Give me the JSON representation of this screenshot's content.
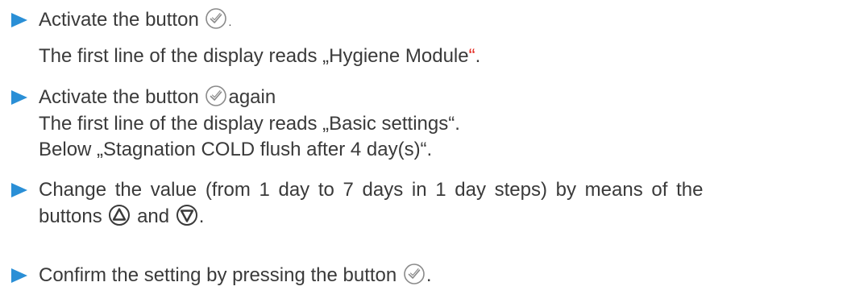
{
  "colors": {
    "text": "#3a3a3a",
    "arrow": "#2a8fd6",
    "icon_stroke": "#8a8a8a",
    "highlight": "#e2231a"
  },
  "step1": {
    "icon": "play-arrow-icon",
    "line1_prefix": "Activate the button",
    "line1_suffix": ".",
    "line2_prefix": "The first line of the display reads „Hygiene Module",
    "line2_quote": "“",
    "line2_suffix": "."
  },
  "step2": {
    "icon": "play-arrow-icon",
    "line1_prefix": "Activate the button",
    "line1_suffix": "again",
    "line2": "The first line of the display reads „Basic settings“.",
    "line3": "Below „Stagnation COLD flush after 4 day(s)“."
  },
  "step3": {
    "icon": "play-arrow-icon",
    "line1": "Change the value (from 1 day to 7 days in 1 day steps) by means of the",
    "line2_prefix": "buttons",
    "line2_mid": "and",
    "line2_suffix": "."
  },
  "step4": {
    "icon": "play-arrow-icon",
    "line1_prefix": "Confirm the setting by pressing the button",
    "line1_suffix": "."
  }
}
